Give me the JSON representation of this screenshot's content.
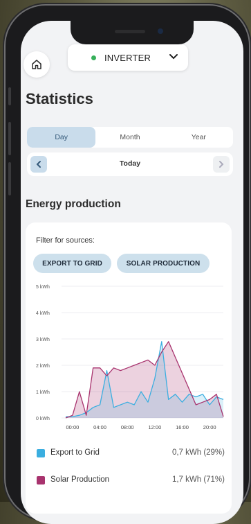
{
  "header": {
    "device": "INVERTER",
    "status_color": "#37b05a"
  },
  "page_title": "Statistics",
  "tabs": [
    {
      "label": "Day",
      "active": true
    },
    {
      "label": "Month",
      "active": false
    },
    {
      "label": "Year",
      "active": false
    }
  ],
  "date_nav": {
    "label": "Today"
  },
  "section_title": "Energy production",
  "filter": {
    "label": "Filter for sources:",
    "chips": [
      "EXPORT TO GRID",
      "SOLAR PRODUCTION"
    ]
  },
  "chart_data": {
    "type": "area",
    "y_ticks": [
      "5 kWh",
      "4 kWh",
      "3 kWh",
      "2 kWh",
      "1 kWh",
      "0 kWh"
    ],
    "x_ticks": [
      "00:00",
      "04:00",
      "08:00",
      "12:00",
      "16:00",
      "20:00"
    ],
    "ylim": [
      0,
      5
    ],
    "series": [
      {
        "name": "Export to Grid",
        "color": "#3aaee0",
        "x": [
          0,
          1,
          2,
          3,
          4,
          5,
          6,
          7,
          8,
          9,
          10,
          11,
          12,
          13,
          14,
          15,
          16,
          17,
          18,
          19,
          20,
          21,
          22,
          23
        ],
        "y": [
          0.05,
          0.05,
          0.1,
          0.2,
          0.4,
          0.5,
          1.8,
          0.4,
          0.5,
          0.6,
          0.5,
          1.0,
          0.6,
          1.5,
          2.9,
          0.7,
          0.9,
          0.6,
          0.9,
          0.8,
          0.9,
          0.5,
          0.8,
          0.7
        ]
      },
      {
        "name": "Solar Production",
        "color": "#a8336e",
        "x": [
          0,
          1,
          2,
          3,
          4,
          5,
          6,
          7,
          8,
          9,
          10,
          11,
          12,
          13,
          14,
          15,
          16,
          17,
          18,
          19,
          20,
          21,
          22,
          23
        ],
        "y": [
          0.0,
          0.1,
          1.0,
          0.1,
          1.9,
          1.9,
          1.6,
          1.9,
          1.8,
          1.9,
          2.0,
          2.1,
          2.2,
          2.0,
          2.5,
          2.9,
          2.3,
          1.7,
          1.1,
          0.5,
          0.6,
          0.7,
          0.9,
          0.05
        ]
      }
    ]
  },
  "legend": [
    {
      "name": "Export to Grid",
      "value": "0,7 kWh (29%)",
      "color": "#3aaee0"
    },
    {
      "name": "Solar Production",
      "value": "1,7 kWh (71%)",
      "color": "#a8336e"
    }
  ]
}
